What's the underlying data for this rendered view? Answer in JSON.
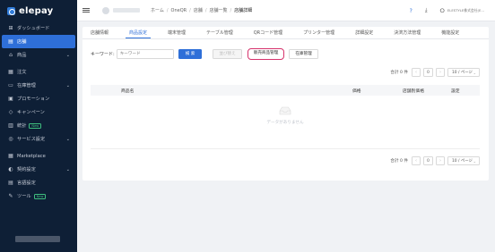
{
  "app": {
    "brand": "elepay"
  },
  "sidebar": {
    "items": [
      {
        "label": "ダッシュボード",
        "icon": "dashboard-icon",
        "glyph": "⊞"
      },
      {
        "label": "店舗",
        "icon": "store-icon",
        "glyph": "▤",
        "active": true
      },
      {
        "label": "商品",
        "icon": "tag-icon",
        "glyph": "⌂",
        "caret": true
      },
      {
        "label": "注文",
        "icon": "order-icon",
        "glyph": "▦"
      },
      {
        "label": "在庫管理",
        "icon": "inventory-icon",
        "glyph": "▭",
        "caret": true
      },
      {
        "label": "プロモーション",
        "icon": "promotion-icon",
        "glyph": "▣"
      },
      {
        "label": "キャンペーン",
        "icon": "campaign-icon",
        "glyph": "◇"
      },
      {
        "label": "統計",
        "icon": "chart-icon",
        "glyph": "▥",
        "badge": "New"
      },
      {
        "label": "サービス設定",
        "icon": "service-icon",
        "glyph": "◎",
        "caret": true
      },
      {
        "label": "Marketplace",
        "icon": "marketplace-icon",
        "glyph": "▦"
      },
      {
        "label": "契約設定",
        "icon": "contract-icon",
        "glyph": "◐",
        "caret": true
      },
      {
        "label": "言語設定",
        "icon": "language-icon",
        "glyph": "▤"
      },
      {
        "label": "ツール",
        "icon": "tool-icon",
        "glyph": "✎",
        "badge": "New"
      }
    ]
  },
  "header": {
    "breadcrumb": [
      "ホーム",
      "OneQR",
      "店舗",
      "店舗一覧",
      "店舗詳細"
    ],
    "help_glyph": "?",
    "download_glyph": "⤓",
    "user_glyph": "ⵔ",
    "user_text": "ELESTYLE株式会社(E..."
  },
  "tabs": [
    {
      "label": "店舗情報"
    },
    {
      "label": "商品設定",
      "active": true
    },
    {
      "label": "端末管理"
    },
    {
      "label": "テーブル管理"
    },
    {
      "label": "QRコード管理"
    },
    {
      "label": "プリンター管理"
    },
    {
      "label": "詳細設定"
    },
    {
      "label": "決済方法管理"
    },
    {
      "label": "機能設定"
    }
  ],
  "toolbar": {
    "keyword_label": "キーワード:",
    "keyword_placeholder": "キーワード",
    "search_label": "検 索",
    "batch_label": "並び替え",
    "sales_mgmt_label": "販売商品管理",
    "inventory_label": "在庫管理"
  },
  "pager": {
    "total": "合計 0 件",
    "prev": "‹",
    "page": "0",
    "next": "›",
    "page_size": "10 / ページ",
    "size_caret": "⌄"
  },
  "table": {
    "columns": [
      "商品名",
      "価格",
      "店舗別価格",
      "設定"
    ],
    "empty_text": "データがありません"
  }
}
